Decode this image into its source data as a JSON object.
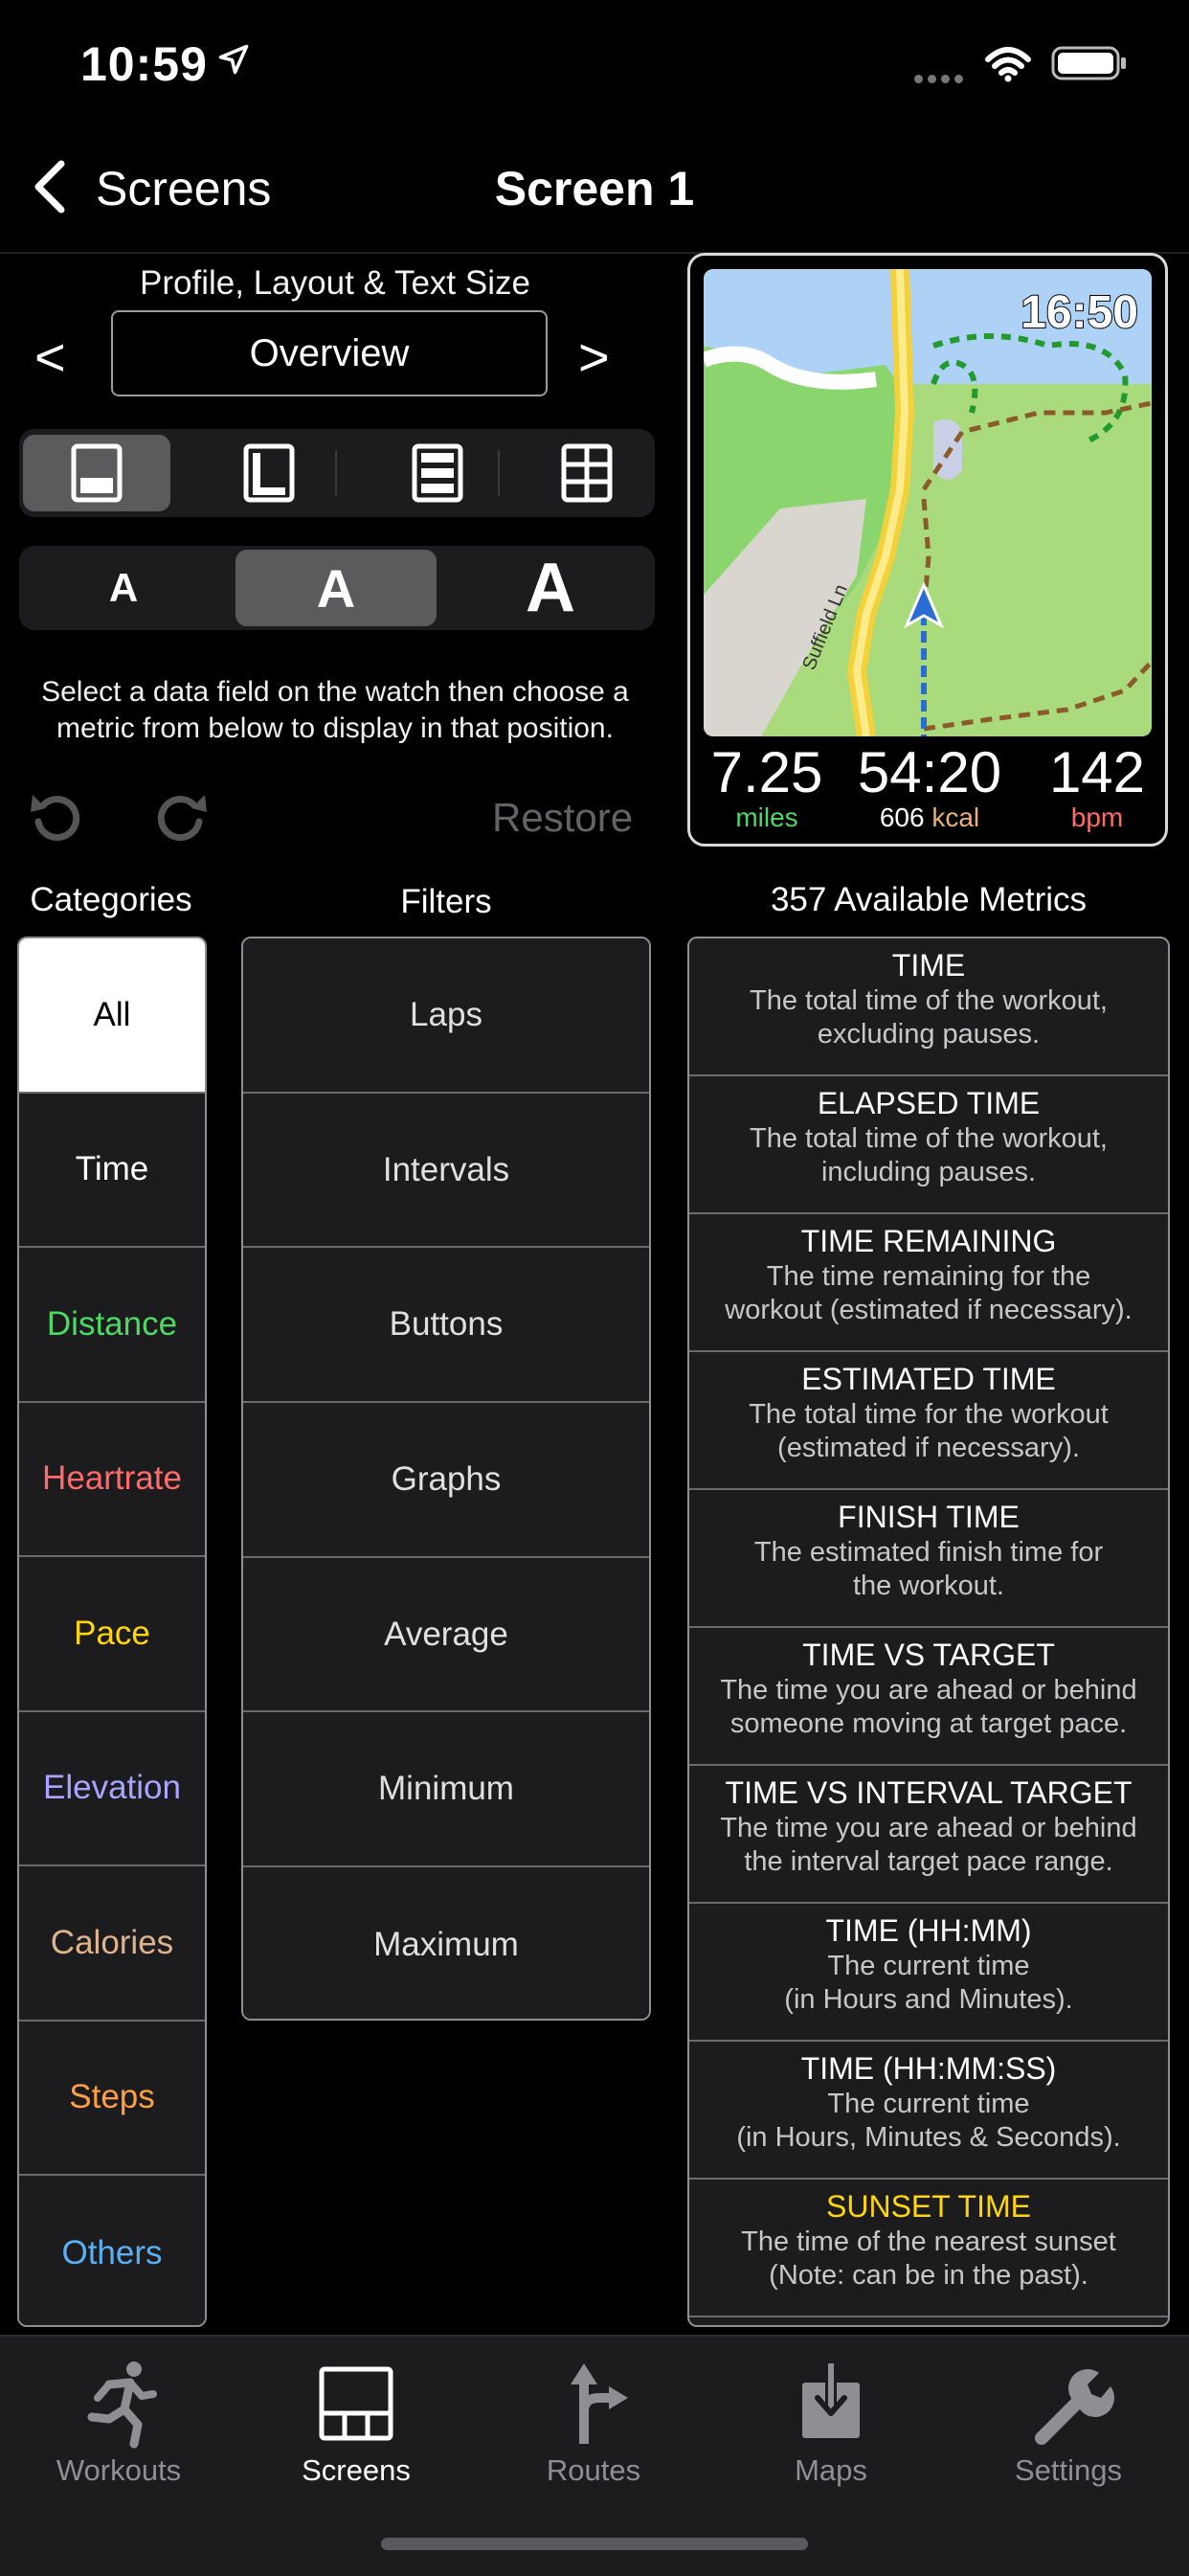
{
  "status_bar": {
    "time": "10:59"
  },
  "nav": {
    "back_label": "Screens",
    "title": "Screen 1"
  },
  "profile": {
    "section_title": "Profile, Layout & Text Size",
    "prev": "<",
    "next": ">",
    "current": "Overview"
  },
  "layout_options": [
    "single-field",
    "l-shape",
    "three-rows",
    "grid-six"
  ],
  "text_sizes": [
    {
      "label": "A",
      "size": "small"
    },
    {
      "label": "A",
      "size": "medium",
      "selected": true
    },
    {
      "label": "A",
      "size": "large"
    }
  ],
  "instructions": "Select a data field on the watch then choose a metric from below to display in that position.",
  "restore_label": "Restore",
  "watch": {
    "map_time": "16:50",
    "street_label": "Suffield Ln",
    "stats": [
      {
        "value": "7.25",
        "unit": "miles",
        "color": "#4cd964"
      },
      {
        "value": "54:20",
        "unit_value": "606",
        "unit": "kcal",
        "color": "#e8b07a"
      },
      {
        "value": "142",
        "unit": "bpm",
        "color": "#ff6b6b"
      }
    ]
  },
  "headers": {
    "categories": "Categories",
    "filters": "Filters",
    "metrics": "357 Available Metrics"
  },
  "categories": [
    {
      "label": "All",
      "color": "#000000",
      "selected": true
    },
    {
      "label": "Time",
      "color": "#ffffff"
    },
    {
      "label": "Distance",
      "color": "#4cd964"
    },
    {
      "label": "Heartrate",
      "color": "#ff6b6b"
    },
    {
      "label": "Pace",
      "color": "#ffd60a"
    },
    {
      "label": "Elevation",
      "color": "#a9a4ff"
    },
    {
      "label": "Calories",
      "color": "#e0b48a"
    },
    {
      "label": "Steps",
      "color": "#ff9f43"
    },
    {
      "label": "Others",
      "color": "#5ab0f5"
    }
  ],
  "filters": [
    "Laps",
    "Intervals",
    "Buttons",
    "Graphs",
    "Average",
    "Minimum",
    "Maximum"
  ],
  "metrics": [
    {
      "title": "TIME",
      "desc1": "The total time of the workout,",
      "desc2": "excluding pauses.",
      "color": "#ffffff"
    },
    {
      "title": "ELAPSED TIME",
      "desc1": "The total time of the workout,",
      "desc2": "including pauses.",
      "color": "#ffffff"
    },
    {
      "title": "TIME REMAINING",
      "desc1": "The time remaining for the",
      "desc2": "workout (estimated if necessary).",
      "color": "#ffffff"
    },
    {
      "title": "ESTIMATED TIME",
      "desc1": "The total time for the workout",
      "desc2": "(estimated if necessary).",
      "color": "#ffffff"
    },
    {
      "title": "FINISH TIME",
      "desc1": "The estimated finish time for",
      "desc2": "the workout.",
      "color": "#ffffff"
    },
    {
      "title": "TIME VS TARGET",
      "desc1": "The time you are ahead or behind",
      "desc2": "someone moving at target pace.",
      "color": "#ffffff"
    },
    {
      "title": "TIME VS INTERVAL TARGET",
      "desc1": "The time you are ahead or behind",
      "desc2": "the interval target pace range.",
      "color": "#ffffff"
    },
    {
      "title": "TIME (HH:MM)",
      "desc1": "The current time",
      "desc2": "(in Hours and Minutes).",
      "color": "#ffffff"
    },
    {
      "title": "TIME (HH:MM:SS)",
      "desc1": "The current time",
      "desc2": "(in Hours, Minutes & Seconds).",
      "color": "#ffffff"
    },
    {
      "title": "SUNSET TIME",
      "desc1": "The time of the nearest sunset",
      "desc2": "(Note: can be in the past).",
      "color": "#ffd60a"
    }
  ],
  "tabs": [
    {
      "label": "Workouts",
      "icon": "runner-icon"
    },
    {
      "label": "Screens",
      "icon": "screens-icon",
      "active": true
    },
    {
      "label": "Routes",
      "icon": "routes-icon"
    },
    {
      "label": "Maps",
      "icon": "maps-download-icon"
    },
    {
      "label": "Settings",
      "icon": "wrench-icon"
    }
  ]
}
